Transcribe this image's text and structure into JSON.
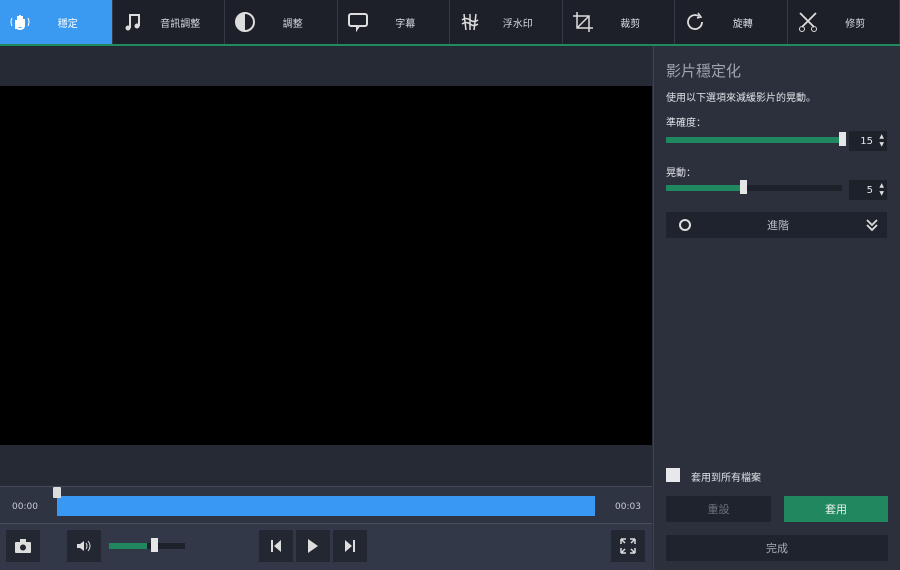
{
  "toolbar": {
    "tabs": [
      {
        "label": "穩定",
        "icon": "stabilize-hand-icon"
      },
      {
        "label": "音訊調整",
        "icon": "music-note-icon"
      },
      {
        "label": "調整",
        "icon": "contrast-icon"
      },
      {
        "label": "字幕",
        "icon": "speech-bubble-icon"
      },
      {
        "label": "浮水印",
        "icon": "watermark-icon"
      },
      {
        "label": "裁剪",
        "icon": "crop-icon"
      },
      {
        "label": "旋轉",
        "icon": "rotate-icon"
      },
      {
        "label": "修剪",
        "icon": "scissors-icon"
      }
    ]
  },
  "player": {
    "time_start": "00:00",
    "time_end": "00:03",
    "volume": 0.5,
    "position": 0
  },
  "panel": {
    "title": "影片穩定化",
    "description": "使用以下選項來減緩影片的晃動。",
    "accuracy": {
      "label": "準確度：",
      "value": "15",
      "fraction": 1.0
    },
    "shakiness": {
      "label": "晃動：",
      "value": "5",
      "fraction": 0.44
    },
    "advanced_label": "進階",
    "apply_all_label": "套用到所有檔案",
    "reset_label": "重設",
    "apply_label": "套用",
    "done_label": "完成"
  },
  "colors": {
    "accent": "#3a9af2",
    "green": "#21875f"
  }
}
